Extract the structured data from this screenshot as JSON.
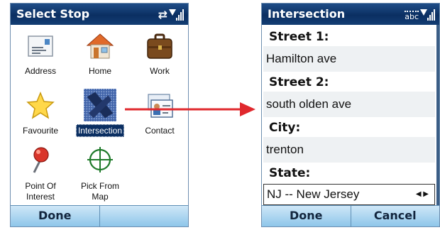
{
  "left_screen": {
    "title": "Select Stop",
    "items": [
      {
        "label": "Address",
        "icon": "envelope-icon"
      },
      {
        "label": "Home",
        "icon": "house-icon"
      },
      {
        "label": "Work",
        "icon": "briefcase-icon"
      },
      {
        "label": "Favourite",
        "icon": "star-icon"
      },
      {
        "label": "Intersection",
        "icon": "intersection-icon",
        "selected": true
      },
      {
        "label": "Contact",
        "icon": "contact-card-icon"
      },
      {
        "label": "Point Of Interest",
        "line1": "Point Of",
        "line2": "Interest",
        "icon": "pushpin-icon"
      },
      {
        "label": "Pick From Map",
        "line1": "Pick From",
        "line2": "Map",
        "icon": "crosshair-icon"
      }
    ],
    "softkeys": {
      "left": "Done",
      "right": ""
    }
  },
  "right_screen": {
    "title": "Intersection",
    "input_mode": "abc",
    "fields": [
      {
        "label": "Street 1:",
        "value": "Hamilton ave"
      },
      {
        "label": "Street 2:",
        "value": "south olden ave"
      },
      {
        "label": "City:",
        "value": "trenton"
      },
      {
        "label": "State:",
        "value": "NJ -- New Jersey"
      }
    ],
    "softkeys": {
      "left": "Done",
      "right": "Cancel"
    }
  },
  "colors": {
    "title_bar": "#0b2f62",
    "softkey_bar": "#a9d6f3",
    "arrow": "#e0282d",
    "selection": "#0b2f62"
  }
}
